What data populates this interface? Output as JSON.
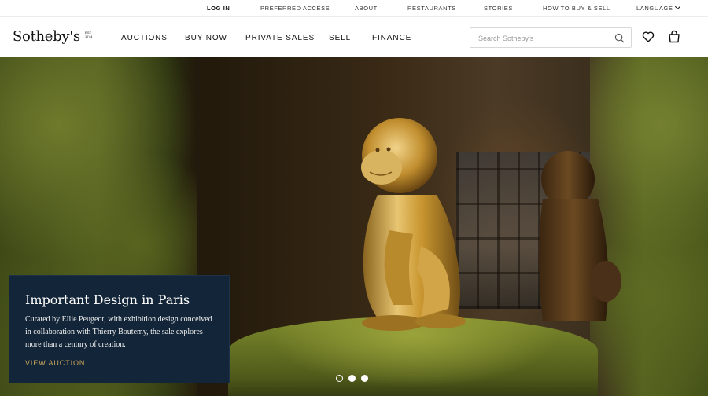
{
  "utility_nav": {
    "login": "LOG IN",
    "preferred_access": "PREFERRED ACCESS",
    "about": "ABOUT",
    "restaurants": "RESTAURANTS",
    "stories": "STORIES",
    "how_to": "HOW TO BUY & SELL",
    "language": "LANGUAGE"
  },
  "header": {
    "logo": "Sotheby's",
    "logo_est": "EST 1744",
    "nav": [
      "AUCTIONS",
      "BUY NOW",
      "PRIVATE SALES",
      "SELL",
      "FINANCE"
    ],
    "search_placeholder": "Search Sotheby's",
    "icons": [
      "search-icon",
      "heart-icon",
      "shopping-bag-icon"
    ]
  },
  "hero": {
    "title": "Important Design in Paris",
    "description": "Curated by Ellie Peugeot, with exhibition design conceived in collaboration with Thierry Boutemy, the sale explores more than a century of creation.",
    "cta": "VIEW AUCTION",
    "slides_total": 3,
    "active_slide": 1
  },
  "colors": {
    "card_bg": "#132538",
    "cta_gold": "#c9a55b",
    "text_dark": "#111111"
  }
}
